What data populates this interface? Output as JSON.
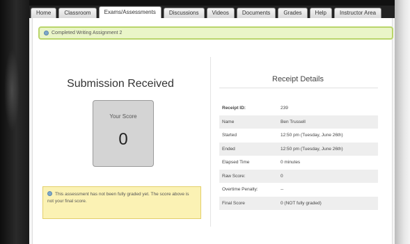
{
  "tabs": [
    {
      "label": "Home",
      "active": false
    },
    {
      "label": "Classroom",
      "active": false
    },
    {
      "label": "Exams/Assessments",
      "active": true
    },
    {
      "label": "Discussions",
      "active": false
    },
    {
      "label": "Videos",
      "active": false
    },
    {
      "label": "Documents",
      "active": false
    },
    {
      "label": "Grades",
      "active": false
    },
    {
      "label": "Help",
      "active": false
    },
    {
      "label": "Instructor Area",
      "active": false
    }
  ],
  "notice": {
    "text": "Completed Writing Assignment 2"
  },
  "submission": {
    "title": "Submission Received",
    "score_label": "Your Score",
    "score_value": "0",
    "warning": "This assessment has not been fully graded yet. The score above is not your final score."
  },
  "receipt": {
    "title": "Receipt Details",
    "rows": [
      {
        "key": "Receipt ID:",
        "value": "239"
      },
      {
        "key": "Name",
        "value": "Ben Trussell"
      },
      {
        "key": "Started",
        "value": "12:50 pm (Tuesday, June 26th)"
      },
      {
        "key": "Ended",
        "value": "12:50 pm (Tuesday, June 26th)"
      },
      {
        "key": "Elapsed Time",
        "value": "0 minutes"
      },
      {
        "key": "Raw Score:",
        "value": "0"
      },
      {
        "key": "Overtime Penalty:",
        "value": "--"
      },
      {
        "key": "Final Score",
        "value": "0 (NOT fully graded)"
      }
    ]
  },
  "colors": {
    "notice_bg": "#eaf5c8",
    "notice_border": "#b9d56a",
    "warning_bg": "#fbf2b4",
    "score_box": "#d4d4d4"
  }
}
